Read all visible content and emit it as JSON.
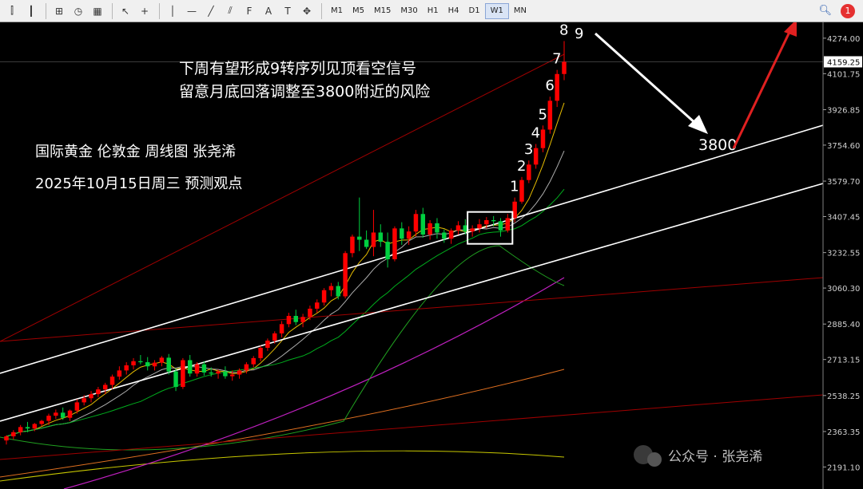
{
  "toolbar": {
    "tools": [
      {
        "name": "bar-chart-icon",
        "glyph": "⫿"
      },
      {
        "name": "candlestick-icon",
        "glyph": "┃"
      },
      {
        "name": "new-chart-icon",
        "glyph": "⊞"
      },
      {
        "name": "history-icon",
        "glyph": "◷"
      },
      {
        "name": "template-icon",
        "glyph": "▦"
      },
      {
        "name": "cursor-icon",
        "glyph": "↖"
      },
      {
        "name": "crosshair-icon",
        "glyph": "+"
      },
      {
        "name": "vertical-line-icon",
        "glyph": "│"
      },
      {
        "name": "horizontal-line-icon",
        "glyph": "—"
      },
      {
        "name": "trendline-icon",
        "glyph": "╱"
      },
      {
        "name": "channel-icon",
        "glyph": "⫽"
      },
      {
        "name": "fibonacci-icon",
        "glyph": "F"
      },
      {
        "name": "text-icon",
        "glyph": "A"
      },
      {
        "name": "label-icon",
        "glyph": "T"
      },
      {
        "name": "shapes-icon",
        "glyph": "✥"
      }
    ],
    "timeframes": [
      "M1",
      "M5",
      "M15",
      "M30",
      "H1",
      "H4",
      "D1",
      "W1",
      "MN"
    ],
    "active_timeframe": "W1",
    "search_icon": "search-icon",
    "notification_count": "1"
  },
  "colors": {
    "background": "#000000",
    "bull": "#ff0000",
    "bear": "#00d040",
    "channel": "#ffffff",
    "arrow_red": "#e02020"
  },
  "annotations": {
    "headline_line1": "下周有望形成9转序列见顶看空信号",
    "headline_line2": "留意月底回落调整至3800附近的风险",
    "info_line1": "国际黄金 伦敦金 周线图 张尧浠",
    "info_line2": "2025年10月15日周三 预测观点",
    "count_labels": [
      "1",
      "2",
      "3",
      "4",
      "5",
      "6",
      "7",
      "8",
      "9"
    ],
    "target_label": "3800",
    "watermark": "公众号 · 张尧浠"
  },
  "chart_data": {
    "type": "candlestick",
    "title": "",
    "y_ticks": [
      "4274.00",
      "4101.75",
      "3926.85",
      "3754.60",
      "3579.70",
      "3407.45",
      "3232.55",
      "3060.30",
      "2885.40",
      "2713.15",
      "2538.25",
      "2363.35",
      "2191.10"
    ],
    "current_price": "4159.25",
    "ylim": [
      2150,
      4320
    ],
    "candles": [
      [
        2320,
        2345,
        2300,
        2340
      ],
      [
        2340,
        2370,
        2325,
        2360
      ],
      [
        2360,
        2395,
        2345,
        2385
      ],
      [
        2385,
        2410,
        2360,
        2378
      ],
      [
        2378,
        2405,
        2365,
        2400
      ],
      [
        2400,
        2420,
        2390,
        2415
      ],
      [
        2415,
        2450,
        2395,
        2440
      ],
      [
        2440,
        2470,
        2425,
        2455
      ],
      [
        2455,
        2480,
        2420,
        2430
      ],
      [
        2430,
        2470,
        2415,
        2465
      ],
      [
        2465,
        2520,
        2450,
        2505
      ],
      [
        2505,
        2540,
        2490,
        2525
      ],
      [
        2525,
        2560,
        2505,
        2545
      ],
      [
        2545,
        2580,
        2530,
        2568
      ],
      [
        2568,
        2600,
        2545,
        2590
      ],
      [
        2590,
        2640,
        2570,
        2630
      ],
      [
        2630,
        2680,
        2615,
        2660
      ],
      [
        2660,
        2700,
        2640,
        2685
      ],
      [
        2685,
        2720,
        2665,
        2705
      ],
      [
        2705,
        2735,
        2690,
        2700
      ],
      [
        2700,
        2725,
        2660,
        2680
      ],
      [
        2680,
        2710,
        2660,
        2698
      ],
      [
        2698,
        2730,
        2680,
        2722
      ],
      [
        2722,
        2740,
        2640,
        2655
      ],
      [
        2655,
        2670,
        2560,
        2580
      ],
      [
        2580,
        2720,
        2570,
        2710
      ],
      [
        2710,
        2735,
        2630,
        2645
      ],
      [
        2645,
        2700,
        2630,
        2690
      ],
      [
        2690,
        2705,
        2635,
        2650
      ],
      [
        2650,
        2675,
        2630,
        2645
      ],
      [
        2645,
        2665,
        2620,
        2655
      ],
      [
        2655,
        2680,
        2620,
        2632
      ],
      [
        2632,
        2660,
        2610,
        2640
      ],
      [
        2640,
        2670,
        2620,
        2660
      ],
      [
        2660,
        2700,
        2645,
        2690
      ],
      [
        2690,
        2730,
        2675,
        2720
      ],
      [
        2720,
        2780,
        2705,
        2770
      ],
      [
        2770,
        2815,
        2755,
        2805
      ],
      [
        2805,
        2850,
        2790,
        2840
      ],
      [
        2840,
        2900,
        2820,
        2885
      ],
      [
        2885,
        2940,
        2870,
        2925
      ],
      [
        2925,
        2955,
        2880,
        2895
      ],
      [
        2895,
        2935,
        2870,
        2920
      ],
      [
        2920,
        2975,
        2905,
        2960
      ],
      [
        2960,
        3005,
        2940,
        2990
      ],
      [
        2990,
        3060,
        2975,
        3050
      ],
      [
        3050,
        3085,
        3020,
        3070
      ],
      [
        3070,
        3090,
        3005,
        3020
      ],
      [
        3020,
        3240,
        3010,
        3230
      ],
      [
        3230,
        3320,
        3210,
        3310
      ],
      [
        3310,
        3500,
        3240,
        3295
      ],
      [
        3295,
        3340,
        3250,
        3260
      ],
      [
        3260,
        3440,
        3215,
        3330
      ],
      [
        3330,
        3370,
        3260,
        3285
      ],
      [
        3285,
        3330,
        3160,
        3200
      ],
      [
        3200,
        3360,
        3190,
        3350
      ],
      [
        3350,
        3380,
        3270,
        3300
      ],
      [
        3300,
        3360,
        3270,
        3335
      ],
      [
        3335,
        3440,
        3310,
        3420
      ],
      [
        3420,
        3450,
        3305,
        3320
      ],
      [
        3320,
        3390,
        3295,
        3375
      ],
      [
        3375,
        3400,
        3300,
        3330
      ],
      [
        3330,
        3345,
        3280,
        3300
      ],
      [
        3300,
        3350,
        3275,
        3340
      ],
      [
        3340,
        3385,
        3320,
        3365
      ],
      [
        3365,
        3395,
        3320,
        3335
      ],
      [
        3335,
        3365,
        3310,
        3350
      ],
      [
        3350,
        3395,
        3330,
        3370
      ],
      [
        3370,
        3405,
        3350,
        3390
      ],
      [
        3390,
        3410,
        3360,
        3385
      ],
      [
        3385,
        3400,
        3310,
        3340
      ],
      [
        3340,
        3420,
        3330,
        3400
      ],
      [
        3400,
        3500,
        3380,
        3480
      ],
      [
        3480,
        3600,
        3470,
        3585
      ],
      [
        3585,
        3680,
        3570,
        3660
      ],
      [
        3660,
        3760,
        3640,
        3740
      ],
      [
        3740,
        3850,
        3720,
        3830
      ],
      [
        3830,
        3990,
        3810,
        3970
      ],
      [
        3970,
        4120,
        3940,
        4100
      ],
      [
        4100,
        4260,
        4070,
        4159.25
      ]
    ],
    "count_label_candle_index": [
      72,
      73,
      74,
      75,
      76,
      77,
      78,
      79
    ]
  }
}
